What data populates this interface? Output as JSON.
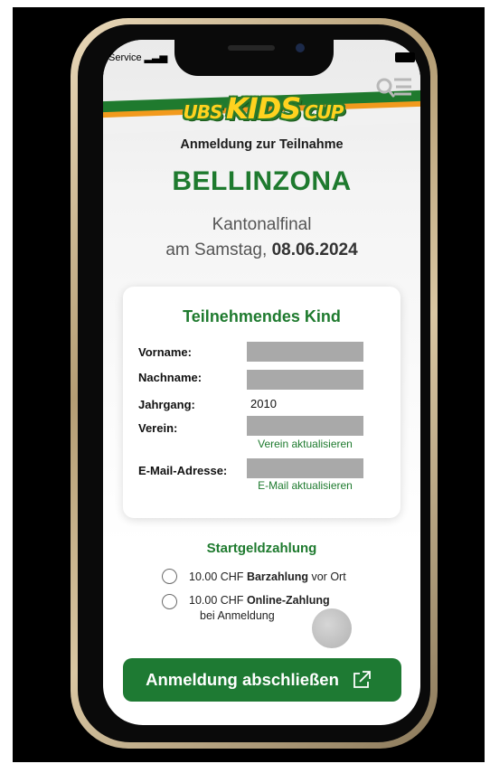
{
  "status": {
    "carrier": "Service"
  },
  "brand": {
    "logo_ubs": "UBS",
    "logo_kids": "KIDS",
    "logo_cup": "CUP",
    "green": "#1e7a2e",
    "orange": "#f29a1d",
    "yellow": "#ffd21f"
  },
  "header": {
    "menu_icon": "search-menu-icon"
  },
  "intro": {
    "subtitle": "Anmeldung zur Teilnahme",
    "city": "BELLINZONA",
    "event_type": "Kantonalfinal",
    "date_prefix": "am Samstag,",
    "date": "08.06.2024"
  },
  "participant": {
    "title": "Teilnehmendes Kind",
    "fields": [
      {
        "label": "Vorname:",
        "value": ""
      },
      {
        "label": "Nachname:",
        "value": ""
      },
      {
        "label": "Jahrgang:",
        "value": "2010"
      },
      {
        "label": "Verein:",
        "value": ""
      },
      {
        "label": "E-Mail-Adresse:",
        "value": ""
      }
    ],
    "update_club_link": "Verein aktualisieren",
    "update_email_link": "E-Mail aktualisieren"
  },
  "payment": {
    "title": "Startgeldzahlung",
    "options": [
      {
        "amount": "10.00 CHF",
        "method": "Barzahlung",
        "suffix": "vor Ort",
        "sub": ""
      },
      {
        "amount": "10.00 CHF",
        "method": "Online-Zahlung",
        "suffix": "",
        "sub": "bei Anmeldung"
      }
    ]
  },
  "cta": {
    "label": "Anmeldung abschließen",
    "icon": "external-link-icon"
  }
}
